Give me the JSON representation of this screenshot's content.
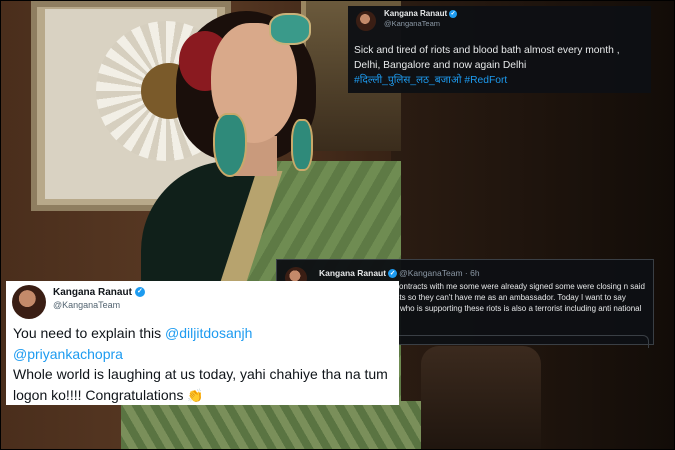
{
  "tweets": [
    {
      "author": "Kangana Ranaut",
      "handle": "@KanganaTeam",
      "text_line1": "Sick and tired of riots and blood bath almost every month , Delhi, Bangalore and now again Delhi",
      "hashtag_1": "#दिल्ली_पुलिस_लठ_बजाओ",
      "hashtag_2": "#RedFort"
    },
    {
      "author": "Kangana Ranaut",
      "handle": "@KanganaTeam",
      "time": "· 6h",
      "text": "Six brands cancelled contracts with me some were already signed some were closing n said I called Farmer terrorists so they can't have me as an ambassador. Today I want to say each and  every Indian who is supporting these riots is also a terrorist including anti national brands."
    },
    {
      "author": "Kangana Ranaut",
      "handle": "@KanganaTeam",
      "text_intro": "You need to explain this",
      "mention_1": "@diljitdosanjh",
      "mention_2": "@priyankachopra",
      "text_rest": "Whole world is laughing at us today, yahi chahiye tha na tum logon ko!!!! Congratulations",
      "emoji": "👏"
    }
  ],
  "icons": {
    "verified": "verified-badge-icon"
  },
  "colors": {
    "link": "#1d9bf0",
    "dark_card": "#0e1014",
    "light_card": "#ffffff"
  }
}
